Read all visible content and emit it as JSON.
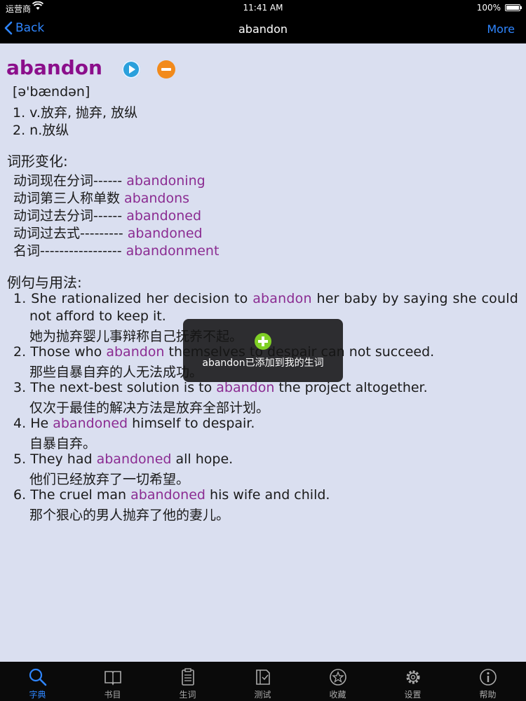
{
  "status": {
    "carrier": "运营商",
    "time": "11:41 AM",
    "battery": "100%"
  },
  "nav": {
    "back": "Back",
    "title": "abandon",
    "more": "More"
  },
  "entry": {
    "headword": "abandon",
    "phonetic": "[ə'bændən]",
    "definitions": [
      "1. v.放弃, 抛弃, 放纵",
      "2. n.放纵"
    ]
  },
  "morph": {
    "title": "词形变化:",
    "items": [
      {
        "label": "动词现在分词------ ",
        "form": "abandoning"
      },
      {
        "label": "动词第三人称单数 ",
        "form": "abandons"
      },
      {
        "label": "动词过去分词------ ",
        "form": "abandoned"
      },
      {
        "label": "动词过去式--------- ",
        "form": "abandoned"
      },
      {
        "label": "名词----------------- ",
        "form": "abandonment"
      }
    ]
  },
  "examples": {
    "title": "例句与用法:",
    "items": [
      {
        "num": "1.",
        "pre": "She rationalized her decision to ",
        "hl": "abandon",
        "post": " her baby by saying she could",
        "cont": "not afford to keep it.",
        "zh": "她为抛弃婴儿事辩称自己抚养不起。"
      },
      {
        "num": "2.",
        "pre": "Those who ",
        "hl": "abandon",
        "post": " themselves to despair can not succeed.",
        "zh": "那些自暴自弃的人无法成功。"
      },
      {
        "num": "3.",
        "pre": "The next-best solution is to ",
        "hl": "abandon",
        "post": " the project altogether.",
        "zh": "仅次于最佳的解决方法是放弃全部计划。"
      },
      {
        "num": "4.",
        "pre": "He ",
        "hl": "abandoned",
        "post": " himself to despair.",
        "zh": "自暴自弃。"
      },
      {
        "num": "5.",
        "pre": "They had ",
        "hl": "abandoned",
        "post": " all hope.",
        "zh": "他们已经放弃了一切希望。"
      },
      {
        "num": "6.",
        "pre": "The cruel man ",
        "hl": "abandoned",
        "post": " his wife and child.",
        "zh": "那个狠心的男人抛弃了他的妻儿。"
      }
    ]
  },
  "toast": {
    "message": "abandon已添加到我的生词"
  },
  "tabs": [
    {
      "label": "字典",
      "icon": "search-icon",
      "active": true
    },
    {
      "label": "书目",
      "icon": "book-icon"
    },
    {
      "label": "生词",
      "icon": "clipboard-icon"
    },
    {
      "label": "测试",
      "icon": "test-icon"
    },
    {
      "label": "收藏",
      "icon": "star-icon"
    },
    {
      "label": "设置",
      "icon": "gear-icon"
    },
    {
      "label": "帮助",
      "icon": "info-icon"
    }
  ],
  "colors": {
    "accent": "#2f86ff",
    "headword": "#8b0e8b",
    "highlight": "#8b2c92",
    "background": "#dadff0"
  }
}
